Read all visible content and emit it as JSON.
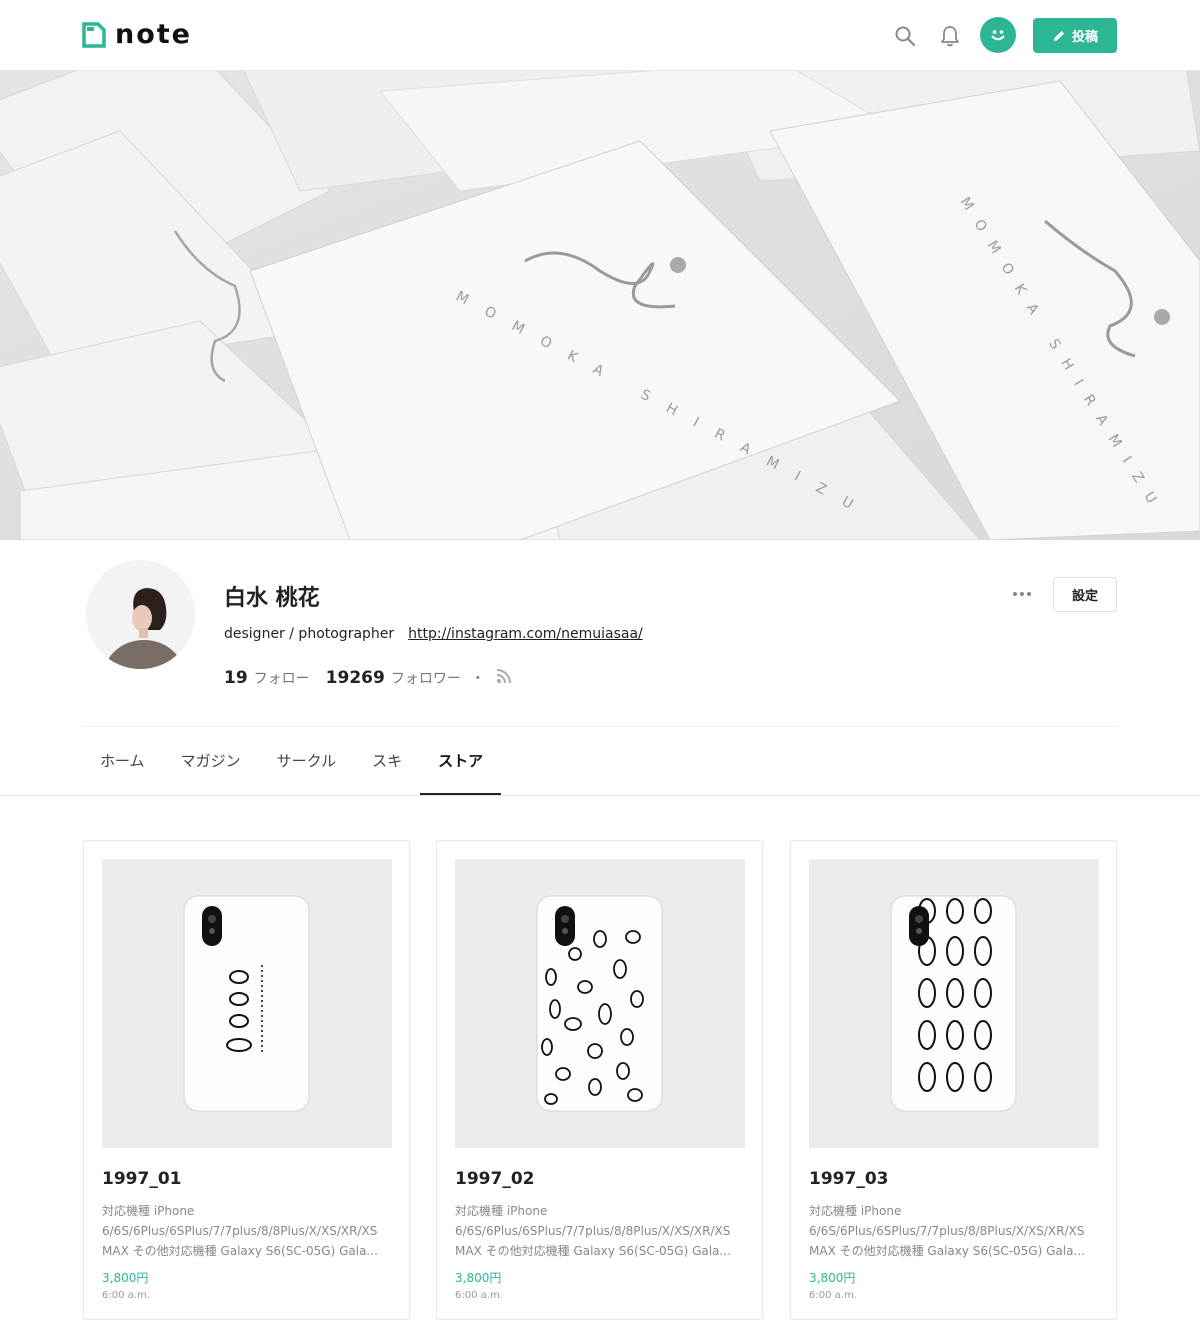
{
  "header": {
    "logo_text": "note",
    "post_label": "投稿",
    "brand_color": "#2cb696",
    "icons": [
      "search-icon",
      "bell-icon",
      "smile-avatar-icon",
      "pencil-icon"
    ]
  },
  "cover": {
    "card_text_1": "MOMOKA SHIRAMIZU",
    "card_text_2": "MOMOKA SHIRAMIZU"
  },
  "profile": {
    "name": "白水 桃花",
    "bio": "designer / photographer",
    "link": "http://instagram.com/nemuiasaa/",
    "follow_count": "19",
    "follow_label": "フォロー",
    "follower_count": "19269",
    "follower_label": "フォロワー",
    "separator": "・",
    "settings_label": "設定"
  },
  "tabs": [
    {
      "label": "ホーム"
    },
    {
      "label": "マガジン"
    },
    {
      "label": "サークル"
    },
    {
      "label": "スキ"
    },
    {
      "label": "ストア"
    }
  ],
  "products": [
    {
      "title": "1997_01",
      "desc": "対応機種 iPhone 6/6S/6Plus/6SPlus/7/7plus/8/8Plus/X/XS/XR/XS MAX その他対応機種 Galaxy S6(SC-05G) Gala...",
      "price": "3,800円",
      "time": "6:00 a.m."
    },
    {
      "title": "1997_02",
      "desc": "対応機種 iPhone 6/6S/6Plus/6SPlus/7/7plus/8/8Plus/X/XS/XR/XS MAX その他対応機種 Galaxy S6(SC-05G) Gala...",
      "price": "3,800円",
      "time": "6:00 a.m."
    },
    {
      "title": "1997_03",
      "desc": "対応機種 iPhone 6/6S/6Plus/6SPlus/7/7plus/8/8Plus/X/XS/XR/XS MAX その他対応機種 Galaxy S6(SC-05G) Gala...",
      "price": "3,800円",
      "time": "6:00 a.m."
    }
  ]
}
